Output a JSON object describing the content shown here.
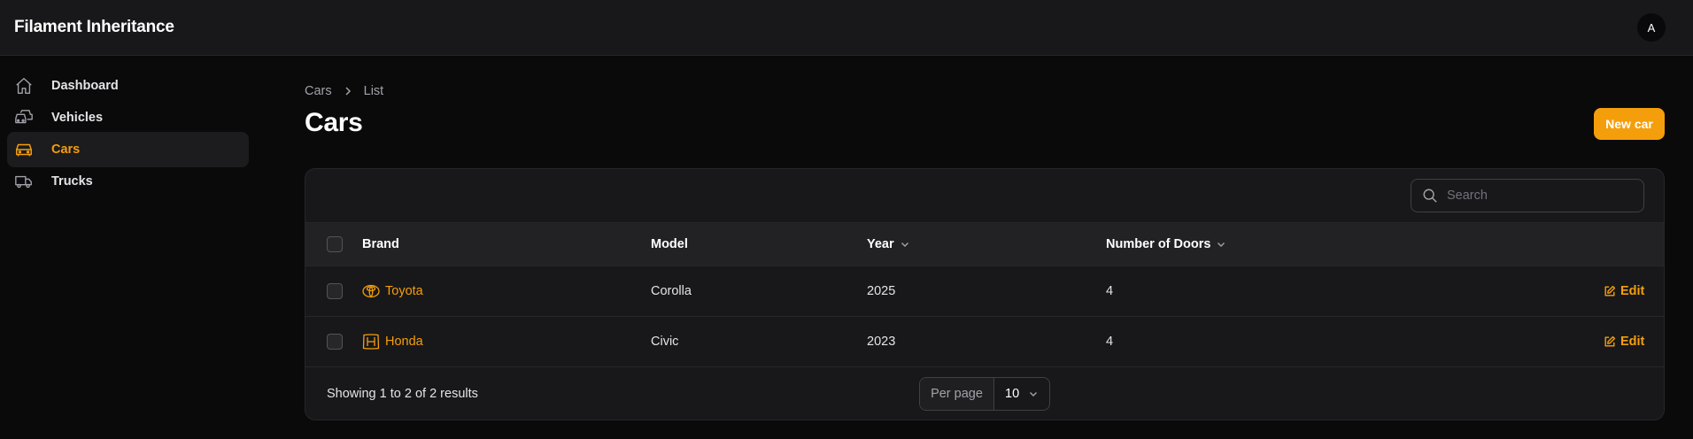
{
  "app": {
    "title": "Filament Inheritance",
    "avatar_initial": "A"
  },
  "sidebar": {
    "items": [
      {
        "label": "Dashboard",
        "icon": "home-icon",
        "active": false
      },
      {
        "label": "Vehicles",
        "icon": "vehicles-icon",
        "active": false
      },
      {
        "label": "Cars",
        "icon": "car-icon",
        "active": true
      },
      {
        "label": "Trucks",
        "icon": "truck-icon",
        "active": false
      }
    ]
  },
  "breadcrumb": {
    "items": [
      "Cars",
      "List"
    ]
  },
  "page": {
    "title": "Cars",
    "new_button": "New car"
  },
  "search": {
    "placeholder": "Search",
    "value": ""
  },
  "table": {
    "columns": [
      {
        "label": "Brand",
        "sortable": false
      },
      {
        "label": "Model",
        "sortable": false
      },
      {
        "label": "Year",
        "sortable": true
      },
      {
        "label": "Number of Doors",
        "sortable": true
      }
    ],
    "rows": [
      {
        "brand": "Toyota",
        "brand_icon": "toyota-logo-icon",
        "model": "Corolla",
        "year": "2025",
        "doors": "4",
        "action": "Edit"
      },
      {
        "brand": "Honda",
        "brand_icon": "honda-logo-icon",
        "model": "Civic",
        "year": "2023",
        "doors": "4",
        "action": "Edit"
      }
    ]
  },
  "pagination": {
    "summary": "Showing 1 to 2 of 2 results",
    "per_page_label": "Per page",
    "per_page_value": "10"
  },
  "colors": {
    "accent": "#f59e0b",
    "background": "#0a0a0b",
    "surface": "#18181b"
  }
}
